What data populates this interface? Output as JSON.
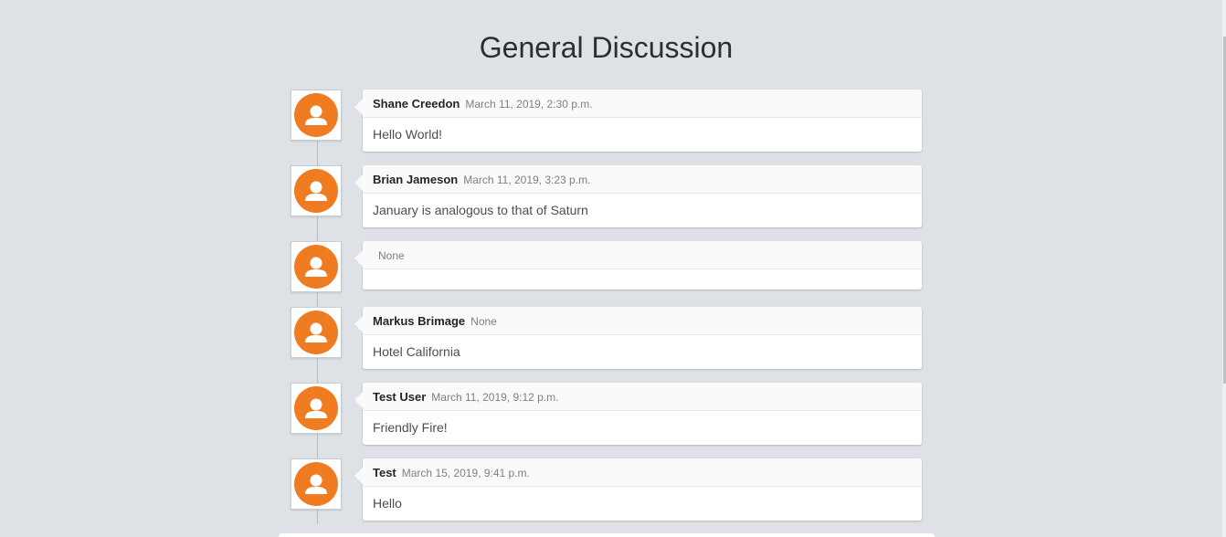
{
  "page": {
    "title": "General Discussion"
  },
  "colors": {
    "background": "#dee1e5",
    "avatar": "#f07c22"
  },
  "comments": [
    {
      "author": "Shane Creedon",
      "date": "March 11, 2019, 2:30 p.m.",
      "text": "Hello World!"
    },
    {
      "author": "Brian Jameson",
      "date": "March 11, 2019, 3:23 p.m.",
      "text": "January is analogous to that of Saturn"
    },
    {
      "author": "",
      "date": "None",
      "text": ""
    },
    {
      "author": "Markus Brimage",
      "date": "None",
      "text": "Hotel California"
    },
    {
      "author": "Test User",
      "date": "March 11, 2019, 9:12 p.m.",
      "text": "Friendly Fire!"
    },
    {
      "author": "Test",
      "date": "March 15, 2019, 9:41 p.m.",
      "text": "Hello"
    }
  ]
}
